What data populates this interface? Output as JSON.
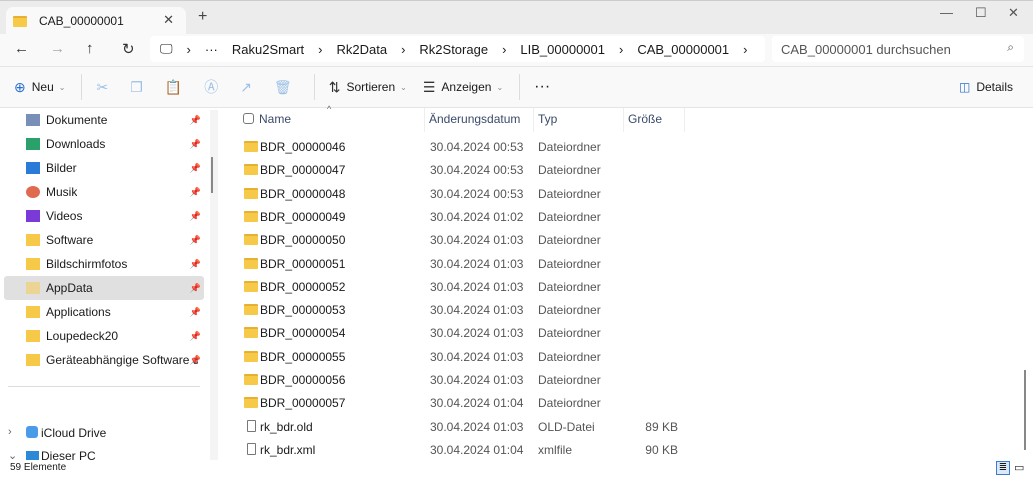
{
  "tab": {
    "title": "CAB_00000001"
  },
  "breadcrumb": [
    "Raku2Smart",
    "Rk2Data",
    "Rk2Storage",
    "LIB_00000001",
    "CAB_00000001"
  ],
  "search": {
    "placeholder": "CAB_00000001 durchsuchen"
  },
  "toolbar": {
    "new": "Neu",
    "sort": "Sortieren",
    "view": "Anzeigen",
    "details": "Details"
  },
  "sidebar": {
    "items": [
      {
        "label": "Dokumente",
        "icon": "documents-icon"
      },
      {
        "label": "Downloads",
        "icon": "download-icon"
      },
      {
        "label": "Bilder",
        "icon": "pictures-icon"
      },
      {
        "label": "Musik",
        "icon": "music-icon"
      },
      {
        "label": "Videos",
        "icon": "videos-icon"
      },
      {
        "label": "Software",
        "icon": "folder-icon"
      },
      {
        "label": "Bildschirmfotos",
        "icon": "folder-icon"
      },
      {
        "label": "AppData",
        "icon": "folder-icon"
      },
      {
        "label": "Applications",
        "icon": "folder-icon"
      },
      {
        "label": "Loupedeck20",
        "icon": "folder-icon"
      },
      {
        "label": "Geräteabhängige Software und",
        "icon": "folder-icon"
      }
    ],
    "icloud": "iCloud Drive",
    "thispc": "Dieser PC"
  },
  "columns": {
    "name": "Name",
    "date": "Änderungsdatum",
    "type": "Typ",
    "size": "Größe"
  },
  "files": [
    {
      "name": "BDR_00000046",
      "date": "30.04.2024 00:53",
      "type": "Dateiordner",
      "size": ""
    },
    {
      "name": "BDR_00000047",
      "date": "30.04.2024 00:53",
      "type": "Dateiordner",
      "size": ""
    },
    {
      "name": "BDR_00000048",
      "date": "30.04.2024 00:53",
      "type": "Dateiordner",
      "size": ""
    },
    {
      "name": "BDR_00000049",
      "date": "30.04.2024 01:02",
      "type": "Dateiordner",
      "size": ""
    },
    {
      "name": "BDR_00000050",
      "date": "30.04.2024 01:03",
      "type": "Dateiordner",
      "size": ""
    },
    {
      "name": "BDR_00000051",
      "date": "30.04.2024 01:03",
      "type": "Dateiordner",
      "size": ""
    },
    {
      "name": "BDR_00000052",
      "date": "30.04.2024 01:03",
      "type": "Dateiordner",
      "size": ""
    },
    {
      "name": "BDR_00000053",
      "date": "30.04.2024 01:03",
      "type": "Dateiordner",
      "size": ""
    },
    {
      "name": "BDR_00000054",
      "date": "30.04.2024 01:03",
      "type": "Dateiordner",
      "size": ""
    },
    {
      "name": "BDR_00000055",
      "date": "30.04.2024 01:03",
      "type": "Dateiordner",
      "size": ""
    },
    {
      "name": "BDR_00000056",
      "date": "30.04.2024 01:03",
      "type": "Dateiordner",
      "size": ""
    },
    {
      "name": "BDR_00000057",
      "date": "30.04.2024 01:04",
      "type": "Dateiordner",
      "size": ""
    },
    {
      "name": "rk_bdr.old",
      "date": "30.04.2024 01:03",
      "type": "OLD-Datei",
      "size": "89 KB"
    },
    {
      "name": "rk_bdr.xml",
      "date": "30.04.2024 01:04",
      "type": "xmlfile",
      "size": "90 KB"
    }
  ],
  "status": {
    "count": "59 Elemente"
  }
}
